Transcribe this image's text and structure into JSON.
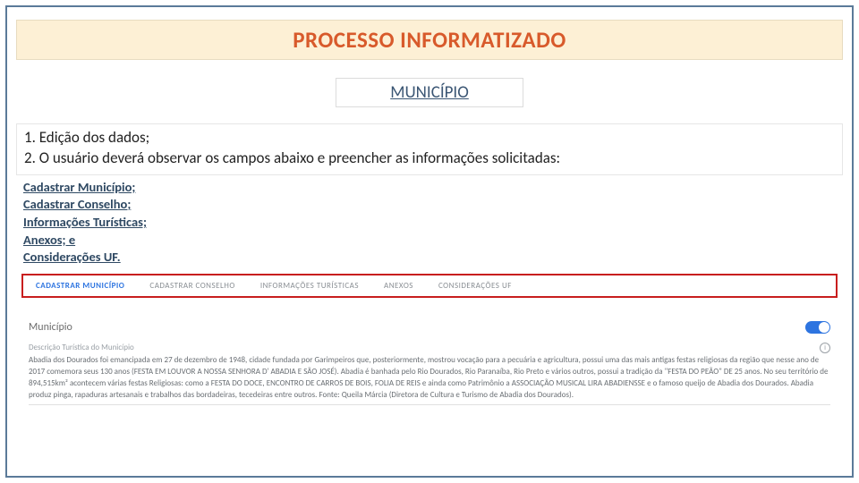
{
  "title": "PROCESSO INFORMATIZADO",
  "subtitle": "MUNICÍPIO",
  "instructions": {
    "line1": "1. Edição dos dados;",
    "line2": "2. O usuário deverá observar os campos abaixo e preencher as informações solicitadas:"
  },
  "sublist": {
    "i1": "Cadastrar Município;",
    "i2": "Cadastrar Conselho;",
    "i3": "Informações Turísticas;",
    "i4": "Anexos; e",
    "i5": "Considerações UF."
  },
  "tabs": {
    "t0": "CADASTRAR MUNICÍPIO",
    "t1": "CADASTRAR CONSELHO",
    "t2": "INFORMAÇÕES TURÍSTICAS",
    "t3": "ANEXOS",
    "t4": "CONSIDERAÇÕES UF"
  },
  "form": {
    "section": "Município",
    "desc_label": "Descrição Turística do Município",
    "desc_text": "Abadia dos Dourados foi emancipada em 27 de dezembro de 1948, cidade fundada por Garimpeiros que, posteriormente, mostrou vocação para a pecuária e agricultura, possui uma das mais antigas festas religiosas da região que nesse ano de 2017 comemora seus 130 anos (FESTA EM LOUVOR A NOSSA SENHORA D' ABADIA E SÃO JOSÉ). Abadia é banhada pelo Rio Dourados, Rio Paranaíba, Rio Preto e vários outros, possui a tradição da \"FESTA DO PEÃO\" DE 25 anos.\nNo seu território de 894,515km²   acontecem várias festas Religiosas:\ncomo a FESTA DO DOCE, ENCONTRO DE CARROS DE BOIS, FOLIA DE REIS e ainda como Patrimônio a ASSOCIAÇÃO MUSICAL LIRA ABADIENSSE e o famoso queijo de Abadia dos Dourados. Abadia produz pinga, rapaduras artesanais e trabalhos das bordadeiras, tecedeiras entre outros. Fonte: Queila Márcia (Diretora de Cultura e Turismo de Abadia dos Dourados)."
  }
}
